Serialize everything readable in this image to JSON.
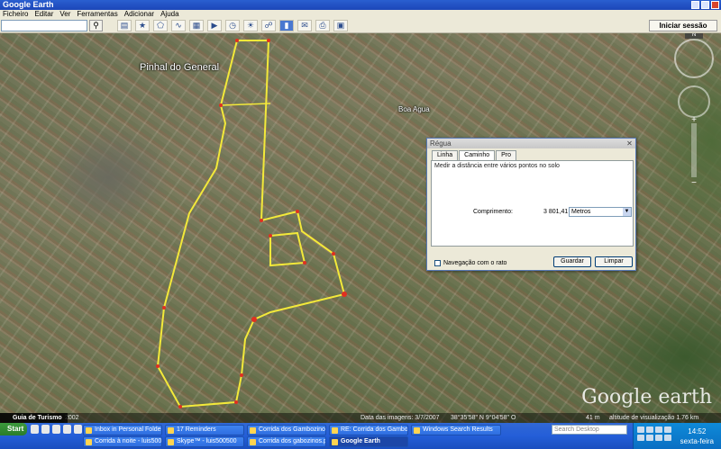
{
  "window": {
    "title": "Google Earth"
  },
  "menu": [
    "Ficheiro",
    "Editar",
    "Ver",
    "Ferramentas",
    "Adicionar",
    "Ajuda"
  ],
  "toolbar": {
    "search_value": "",
    "signin_label": "Iniciar sessão",
    "tools": [
      "sidebar-icon",
      "placemark-icon",
      "polygon-icon",
      "path-icon",
      "overlay-icon",
      "tour-icon",
      "history-icon",
      "sun-icon",
      "planets-icon",
      "ruler-icon",
      "email-icon",
      "print-icon",
      "maps-icon"
    ]
  },
  "map": {
    "places": [
      "Pinhal do General",
      "Boa Agua"
    ],
    "logo": "Google earth",
    "tour_label": "Guia de Turismo",
    "year": "2002",
    "status": {
      "imagery_date": "Data das imagens: 3/7/2007",
      "coords": "38°35'58\" N  9°04'58\" O",
      "elevation": "41 m",
      "eye_alt": "altitude de visualização  1.76 km"
    }
  },
  "ruler": {
    "title": "Régua",
    "tabs": [
      "Linha",
      "Caminho",
      "Pro"
    ],
    "active_tab": "Caminho",
    "description": "Medir a distância entre vários pontos no solo",
    "length_label": "Comprimento:",
    "length_value": "3 801,41",
    "unit": "Metros",
    "mouse_nav_label": "Navegação com o rato",
    "mouse_nav_checked": false,
    "save_label": "Guardar",
    "clear_label": "Limpar"
  },
  "taskbar": {
    "start_label": "Start",
    "row1": [
      "Inbox in Personal Folder...",
      "17 Reminders",
      "Corrida dos Gambozinos...",
      "RE: Corrida dos Gamboz...",
      "Windows Search Results"
    ],
    "row2": [
      "Corrida à noite - luis500...",
      "Skype™ - luis500500",
      "Corrida dos gabozinos.p...",
      "Google Earth"
    ],
    "active_task": "Google Earth",
    "desktop_search_placeholder": "Search Desktop",
    "time": "14:52",
    "day": "sexta-feira"
  }
}
